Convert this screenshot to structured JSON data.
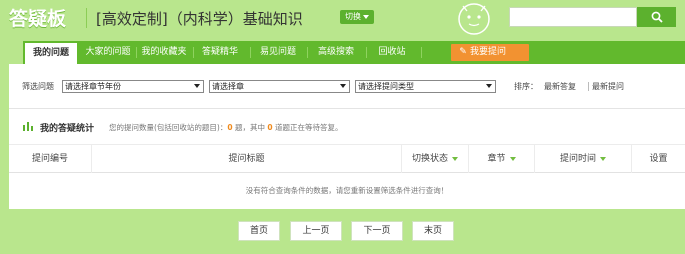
{
  "header": {
    "logo": "答疑板",
    "course_title": "[高效定制]（内科学）基础知识",
    "switch_label": "切换",
    "search_placeholder": "",
    "colors": {
      "background": "#b9e68d",
      "accent": "#5cb12e"
    }
  },
  "nav": {
    "items": [
      {
        "label": "我的问题",
        "active": true
      },
      {
        "label": "大家的问题"
      },
      {
        "label": "我的收藏夹"
      },
      {
        "label": "答疑精华"
      },
      {
        "label": "易见问题"
      },
      {
        "label": "高级搜索"
      },
      {
        "label": "回收站"
      }
    ],
    "ask_label": "我要提问",
    "ask_color": "#f29231"
  },
  "filter": {
    "label": "筛选问题",
    "selects": [
      "请选择章节年份",
      "请选择章",
      "请选择提问类型",
      "请选择提问类型"
    ],
    "sort_label": "排序：",
    "sort_options": [
      "最新答复",
      "最新提问"
    ]
  },
  "stats": {
    "title": "我的答疑统计",
    "text_prefix": "您的提问数量(包括回收站的题目)：",
    "count": "0",
    "text_mid": " 题，其中 ",
    "waiting": "0",
    "text_suffix": " 道题正在等待答复。"
  },
  "table": {
    "columns": [
      "提问编号",
      "提问标题",
      "切换状态",
      "章节",
      "提问时间",
      "设置"
    ],
    "empty_message": "没有符合查询条件的数据，请您重新设置筛选条件进行查询！"
  },
  "pager": {
    "first": "首页",
    "prev": "上一页",
    "next": "下一页",
    "last": "末页"
  }
}
